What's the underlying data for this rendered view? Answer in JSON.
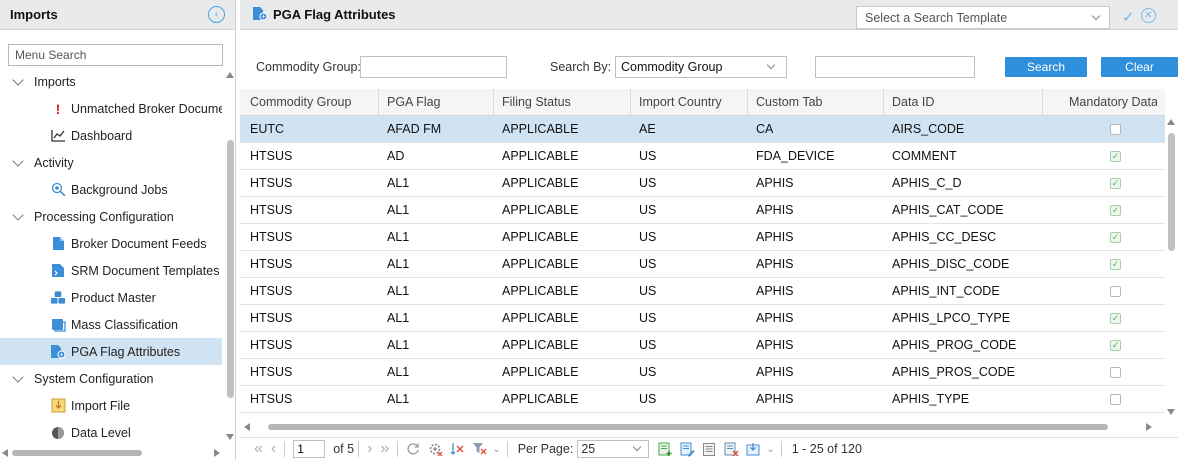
{
  "sidebar": {
    "title": "Imports",
    "search_placeholder": "Menu Search",
    "items": [
      {
        "label": "Imports",
        "kind": "group",
        "icon": "chevron-down-icon"
      },
      {
        "label": "Unmatched Broker Documen",
        "kind": "item",
        "icon": "exclamation-icon"
      },
      {
        "label": "Dashboard",
        "kind": "item",
        "icon": "line-chart-icon"
      },
      {
        "label": "Activity",
        "kind": "group",
        "icon": "chevron-down-icon"
      },
      {
        "label": "Background Jobs",
        "kind": "item",
        "icon": "gear-search-icon"
      },
      {
        "label": "Processing Configuration",
        "kind": "group",
        "icon": "chevron-down-icon"
      },
      {
        "label": "Broker Document Feeds",
        "kind": "item",
        "icon": "document-icon"
      },
      {
        "label": "SRM Document Templates",
        "kind": "item",
        "icon": "template-document-icon"
      },
      {
        "label": "Product Master",
        "kind": "item",
        "icon": "cubes-icon"
      },
      {
        "label": "Mass Classification",
        "kind": "item",
        "icon": "classification-icon"
      },
      {
        "label": "PGA Flag Attributes",
        "kind": "item",
        "icon": "flag-document-icon",
        "selected": true
      },
      {
        "label": "System Configuration",
        "kind": "group",
        "icon": "chevron-down-icon"
      },
      {
        "label": "Import File",
        "kind": "item",
        "icon": "import-file-icon"
      },
      {
        "label": "Data Level",
        "kind": "item",
        "icon": "data-level-icon"
      }
    ]
  },
  "header": {
    "title": "PGA Flag Attributes",
    "template_placeholder": "Select a Search Template"
  },
  "filters": {
    "commodity_group_label": "Commodity Group:",
    "commodity_group_value": "",
    "search_by_label": "Search By:",
    "search_by_value": "Commodity Group",
    "search_text_value": "",
    "search_button": "Search",
    "clear_button": "Clear"
  },
  "grid": {
    "columns": [
      "Commodity Group",
      "PGA Flag",
      "Filing Status",
      "Import Country",
      "Custom Tab",
      "Data ID",
      "Mandatory Data"
    ],
    "rows": [
      {
        "cells": [
          "EUTC",
          "AFAD FM",
          "APPLICABLE",
          "AE",
          "CA",
          "AIRS_CODE"
        ],
        "mandatory": false,
        "selected": true
      },
      {
        "cells": [
          "HTSUS",
          "AD",
          "APPLICABLE",
          "US",
          "FDA_DEVICE",
          "COMMENT"
        ],
        "mandatory": true
      },
      {
        "cells": [
          "HTSUS",
          "AL1",
          "APPLICABLE",
          "US",
          "APHIS",
          "APHIS_C_D"
        ],
        "mandatory": true
      },
      {
        "cells": [
          "HTSUS",
          "AL1",
          "APPLICABLE",
          "US",
          "APHIS",
          "APHIS_CAT_CODE"
        ],
        "mandatory": true
      },
      {
        "cells": [
          "HTSUS",
          "AL1",
          "APPLICABLE",
          "US",
          "APHIS",
          "APHIS_CC_DESC"
        ],
        "mandatory": true
      },
      {
        "cells": [
          "HTSUS",
          "AL1",
          "APPLICABLE",
          "US",
          "APHIS",
          "APHIS_DISC_CODE"
        ],
        "mandatory": true
      },
      {
        "cells": [
          "HTSUS",
          "AL1",
          "APPLICABLE",
          "US",
          "APHIS",
          "APHIS_INT_CODE"
        ],
        "mandatory": false
      },
      {
        "cells": [
          "HTSUS",
          "AL1",
          "APPLICABLE",
          "US",
          "APHIS",
          "APHIS_LPCO_TYPE"
        ],
        "mandatory": true
      },
      {
        "cells": [
          "HTSUS",
          "AL1",
          "APPLICABLE",
          "US",
          "APHIS",
          "APHIS_PROG_CODE"
        ],
        "mandatory": true
      },
      {
        "cells": [
          "HTSUS",
          "AL1",
          "APPLICABLE",
          "US",
          "APHIS",
          "APHIS_PROS_CODE"
        ],
        "mandatory": false
      },
      {
        "cells": [
          "HTSUS",
          "AL1",
          "APPLICABLE",
          "US",
          "APHIS",
          "APHIS_TYPE"
        ],
        "mandatory": false
      }
    ]
  },
  "pager": {
    "page": "1",
    "of_label": "of 5",
    "per_page_label": "Per Page:",
    "per_page_value": "25",
    "range_label": "1 - 25 of 120"
  },
  "colors": {
    "accent": "#2e8fdc",
    "selected_row": "#cfe3f3",
    "header_bg": "#e8eaec",
    "check_green": "#5aad5a"
  }
}
